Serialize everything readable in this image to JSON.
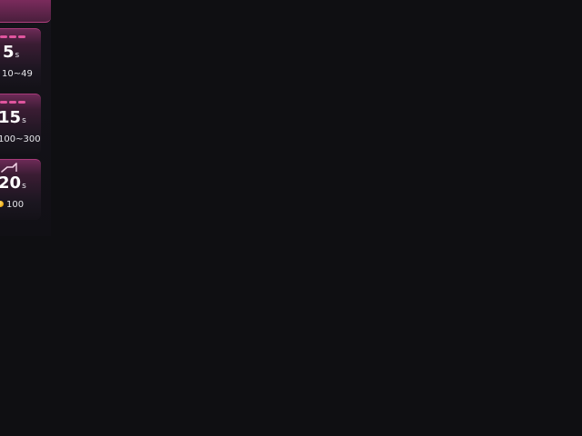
{
  "header": {
    "icon": "pink-glyph-icon",
    "glyph": "⋲"
  },
  "cards": [
    {
      "indicator": "dash-bar",
      "time_value": "5",
      "time_unit": "s",
      "range": "10~49"
    },
    {
      "indicator": "dash-bar",
      "time_value": "15",
      "time_unit": "s",
      "range": "100~300"
    },
    {
      "indicator": "trend-up-icon",
      "time_value": "20",
      "time_unit": "s",
      "reward": "100",
      "reward_icon": "coin-icon"
    }
  ],
  "colors": {
    "accent": "#e0559f",
    "card_top": "#6b2a56",
    "background": "#0f0f12",
    "coin": "#f3b21e"
  }
}
